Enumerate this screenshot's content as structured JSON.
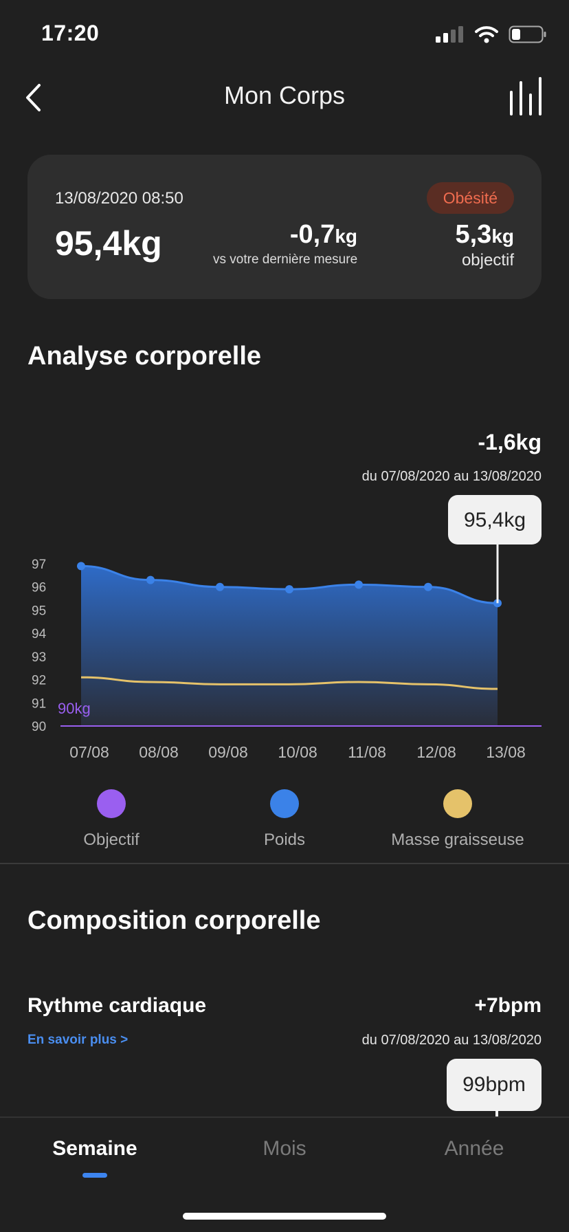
{
  "status": {
    "time": "17:20"
  },
  "header": {
    "title": "Mon Corps"
  },
  "summary": {
    "date": "13/08/2020 08:50",
    "weight": "95,4kg",
    "badge": "Obésité",
    "delta_value": "-0,7",
    "delta_unit": "kg",
    "delta_caption": "vs votre dernière mesure",
    "goal_value": "5,3",
    "goal_unit": "kg",
    "goal_caption": "objectif"
  },
  "analysis": {
    "title": "Analyse corporelle",
    "change": "-1,6kg",
    "range": "du 07/08/2020 au 13/08/2020"
  },
  "chart_data": {
    "type": "area",
    "x": [
      "07/08",
      "08/08",
      "09/08",
      "10/08",
      "11/08",
      "12/08",
      "13/08"
    ],
    "ylim": [
      90,
      97
    ],
    "yticks": [
      97,
      96,
      95,
      94,
      93,
      92,
      91,
      90
    ],
    "goal_label": "90kg",
    "tooltip": "95,4kg",
    "series": [
      {
        "name": "Poids",
        "values": [
          96.9,
          96.3,
          96.0,
          95.9,
          96.1,
          96.0,
          95.3
        ]
      },
      {
        "name": "Masse graisseuse",
        "values": [
          92.1,
          91.9,
          91.8,
          91.8,
          91.9,
          91.8,
          91.6
        ]
      },
      {
        "name": "Objectif",
        "values": [
          90,
          90,
          90,
          90,
          90,
          90,
          90
        ]
      }
    ],
    "colors": {
      "weight": "#3b82e8",
      "fat": "#e5c26a",
      "goal": "#9a5ff0"
    }
  },
  "legend": {
    "items": [
      {
        "label": "Objectif",
        "color": "#9a5ff0"
      },
      {
        "label": "Poids",
        "color": "#3b82e8"
      },
      {
        "label": "Masse graisseuse",
        "color": "#e5c26a"
      }
    ]
  },
  "composition": {
    "title": "Composition corporelle",
    "heart_title": "Rythme cardiaque",
    "learn_more": "En savoir plus >",
    "heart_change": "+7bpm",
    "heart_range": "du 07/08/2020 au 13/08/2020",
    "heart_tooltip": "99bpm"
  },
  "tabs": {
    "items": [
      "Semaine",
      "Mois",
      "Année"
    ],
    "active": "Semaine"
  }
}
